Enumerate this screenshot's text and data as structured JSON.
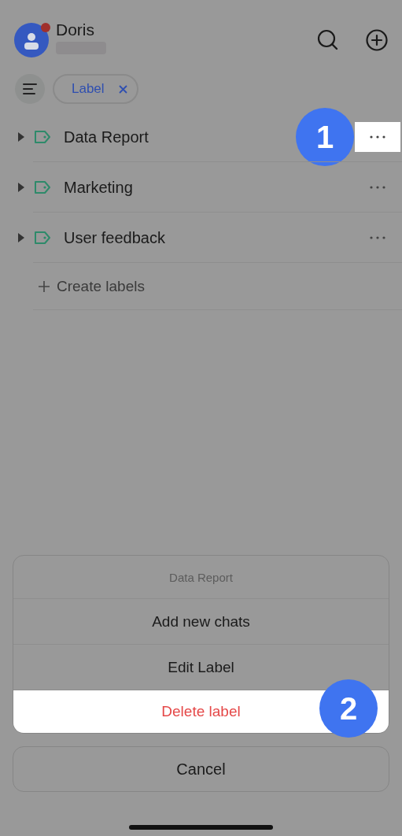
{
  "header": {
    "user_name": "Doris",
    "has_notification": true
  },
  "filter": {
    "chip": "Label"
  },
  "labels": [
    {
      "name": "Data Report",
      "expanded": false,
      "highlighted": true,
      "step": "1"
    },
    {
      "name": "Marketing",
      "expanded": false,
      "highlighted": false
    },
    {
      "name": "User feedback",
      "expanded": false,
      "highlighted": false
    }
  ],
  "create_label": "Create labels",
  "sheet": {
    "title": "Data Report",
    "actions": [
      {
        "label": "Add new chats",
        "kind": "normal",
        "highlighted": false
      },
      {
        "label": "Edit Label",
        "kind": "normal",
        "highlighted": false
      },
      {
        "label": "Delete label",
        "kind": "danger",
        "highlighted": true,
        "step": "2"
      }
    ],
    "cancel": "Cancel"
  }
}
